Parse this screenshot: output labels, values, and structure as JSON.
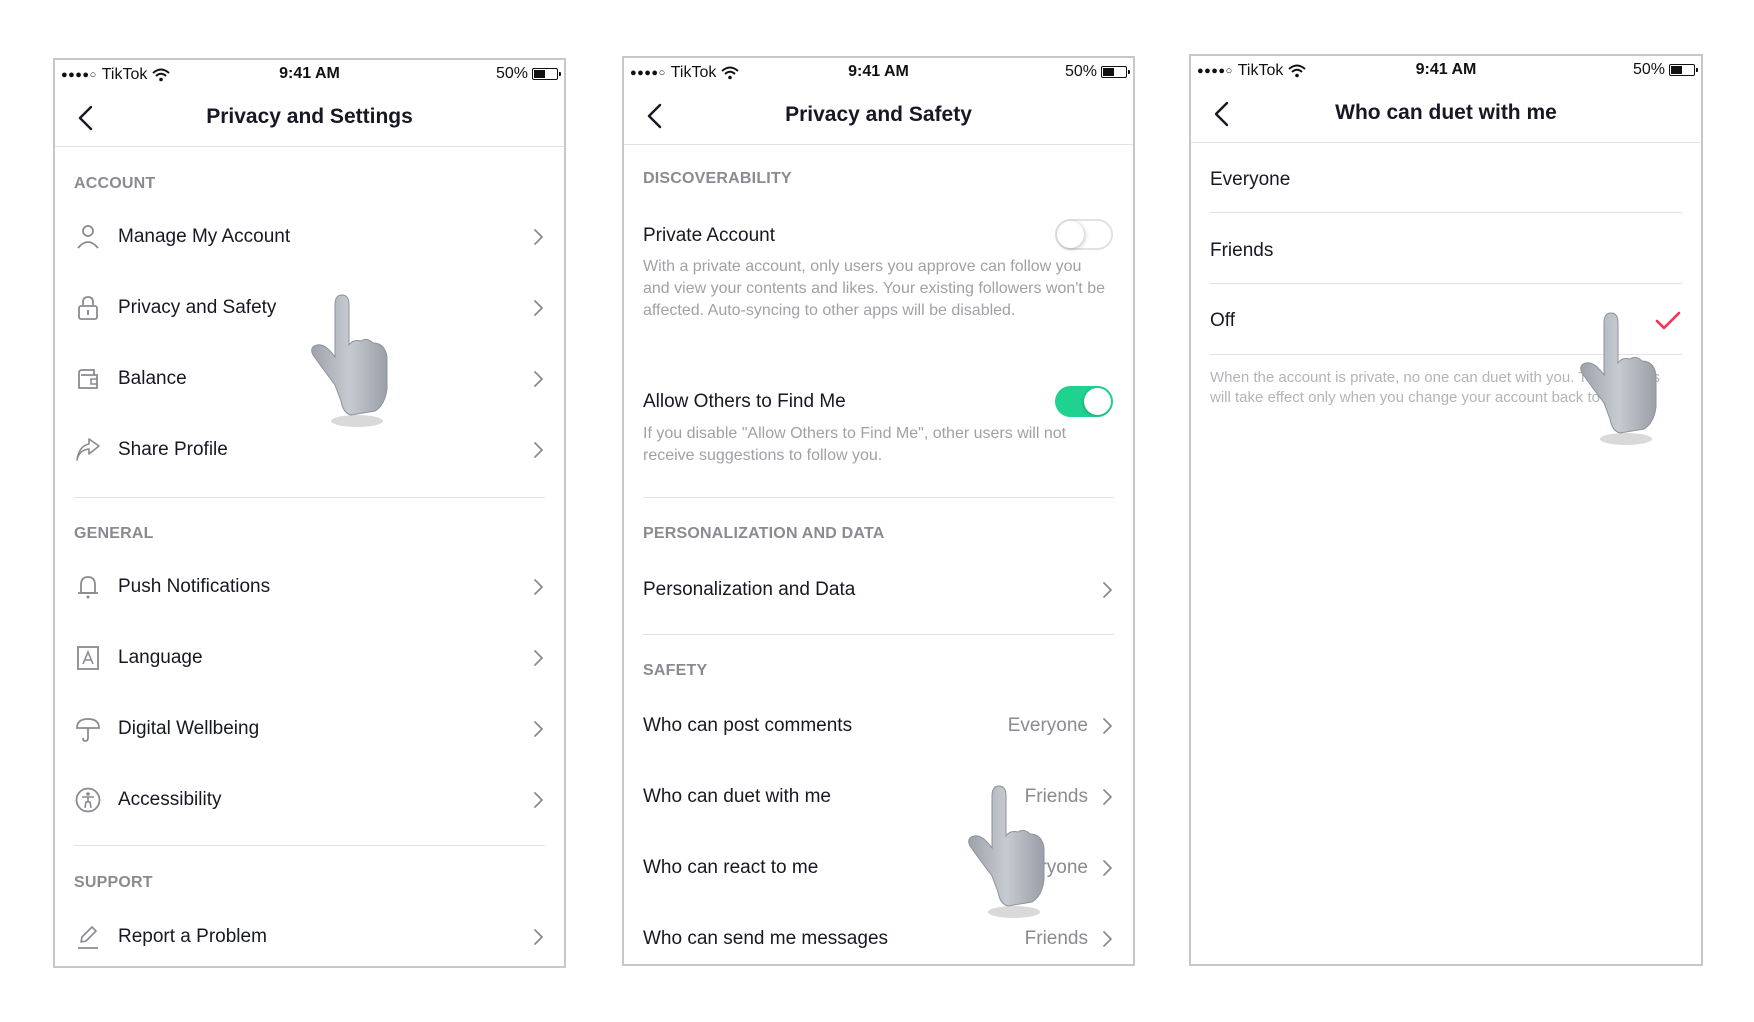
{
  "status_bar": {
    "signal": "●●●●○",
    "carrier": "TikTok",
    "time": "9:41 AM",
    "battery_percent": "50%",
    "battery_level": 0.5
  },
  "screen1": {
    "title": "Privacy and Settings",
    "sections": [
      {
        "header": "ACCOUNT",
        "items": [
          {
            "label": "Manage My Account",
            "icon": "person-icon"
          },
          {
            "label": "Privacy and Safety",
            "icon": "lock-icon"
          },
          {
            "label": "Balance",
            "icon": "wallet-icon"
          },
          {
            "label": "Share Profile",
            "icon": "share-icon"
          }
        ]
      },
      {
        "header": "GENERAL",
        "items": [
          {
            "label": "Push Notifications",
            "icon": "bell-icon"
          },
          {
            "label": "Language",
            "icon": "language-icon"
          },
          {
            "label": "Digital Wellbeing",
            "icon": "umbrella-icon"
          },
          {
            "label": "Accessibility",
            "icon": "accessibility-icon"
          }
        ]
      },
      {
        "header": "SUPPORT",
        "items": [
          {
            "label": "Report a Problem",
            "icon": "pencil-icon"
          }
        ]
      }
    ]
  },
  "screen2": {
    "title": "Privacy and Safety",
    "discoverability": {
      "header": "DISCOVERABILITY",
      "private_account": {
        "label": "Private Account",
        "enabled": false,
        "description": "With a private account, only users you approve can follow you and view your contents and likes. Your existing followers won't be affected. Auto-syncing to other apps will be disabled."
      },
      "allow_find": {
        "label": "Allow Others to Find Me",
        "enabled": true,
        "description": "If you disable \"Allow Others to Find Me\", other users will not receive suggestions to follow you."
      }
    },
    "personalization": {
      "header": "PERSONALIZATION AND DATA",
      "item": "Personalization and Data"
    },
    "safety": {
      "header": "SAFETY",
      "items": [
        {
          "label": "Who can post comments",
          "value": "Everyone"
        },
        {
          "label": "Who can duet with me",
          "value": "Friends"
        },
        {
          "label": "Who can react to me",
          "value": "Everyone"
        },
        {
          "label": "Who can send me messages",
          "value": "Friends"
        }
      ]
    }
  },
  "screen3": {
    "title": "Who can duet with me",
    "options": [
      {
        "label": "Everyone",
        "selected": false
      },
      {
        "label": "Friends",
        "selected": false
      },
      {
        "label": "Off",
        "selected": true
      }
    ],
    "note": "When the account is private, no one can duet with you. The settings will take effect only when you change your account back to public."
  },
  "colors": {
    "toggle_on": "#20d28f",
    "check": "#fe2c55",
    "secondary_text": "#8a8b91"
  }
}
